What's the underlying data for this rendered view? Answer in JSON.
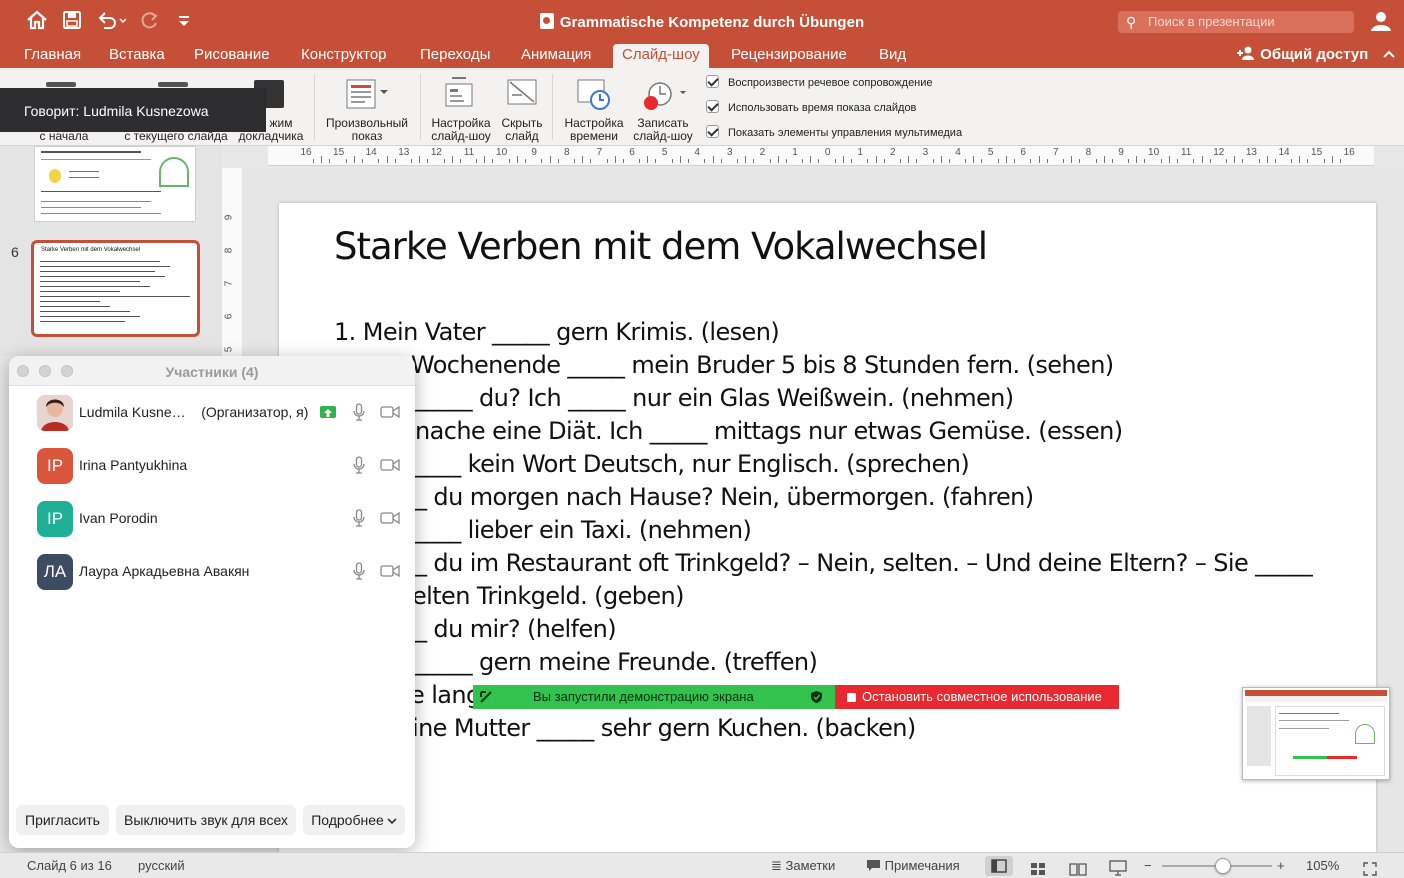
{
  "window": {
    "title": "Grammatische Kompetenz durch Übungen"
  },
  "search": {
    "placeholder": "Поиск в презентации"
  },
  "tabs": [
    {
      "label": "Главная"
    },
    {
      "label": "Вставка"
    },
    {
      "label": "Рисование"
    },
    {
      "label": "Конструктор"
    },
    {
      "label": "Переходы"
    },
    {
      "label": "Анимация"
    },
    {
      "label": "Слайд-шоу",
      "active": true
    },
    {
      "label": "Рецензирование"
    },
    {
      "label": "Вид"
    }
  ],
  "share": {
    "label": "Общий доступ"
  },
  "ribbon": {
    "from_start": "с начала",
    "from_current": "с текущего слайда",
    "presenter_partial": "жим",
    "presenter_mode": "докладчика",
    "custom_show": [
      "Произвольный",
      "показ"
    ],
    "setup_show": [
      "Настройка",
      "слайд-шоу"
    ],
    "hide_slide": [
      "Скрыть",
      "слайд"
    ],
    "rehearse": [
      "Настройка",
      "времени"
    ],
    "record": [
      "Записать",
      "слайд-шоу"
    ],
    "checkboxes": [
      {
        "label": "Воспроизвести речевое сопровождение",
        "checked": true
      },
      {
        "label": "Использовать время показа слайдов",
        "checked": true
      },
      {
        "label": "Показать элементы управления мультимедиа",
        "checked": true
      }
    ]
  },
  "speaker": {
    "text": "Говорит: Ludmila Kusnezowa"
  },
  "ruler": {
    "ticks": [
      "16",
      "15",
      "14",
      "13",
      "12",
      "11",
      "10",
      "9",
      "8",
      "7",
      "6",
      "5",
      "4",
      "3",
      "2",
      "1",
      "0",
      "1",
      "2",
      "3",
      "4",
      "5",
      "6",
      "7",
      "8",
      "9",
      "10",
      "11",
      "12",
      "13",
      "14",
      "15",
      "16"
    ],
    "vticks": [
      "9",
      "8",
      "7",
      "6",
      "5"
    ]
  },
  "thumbnails": {
    "current_number": "6",
    "current_title": "Starke Verben mit dem Vokalwechsel"
  },
  "slide": {
    "title": "Starke Verben mit dem Vokalwechsel",
    "lines": [
      "1. Mein Vater _____ gern Krimis. (lesen)",
      "Wochenende _____ mein Bruder 5 bis 8 Stunden fern. (sehen)",
      "_____ du? Ich _____ nur ein Glas Weißwein. (nehmen)",
      "nache eine Diät. Ich _____ mittags nur etwas Gemüse. (essen)",
      "____ kein Wort Deutsch, nur Englisch. (sprechen)",
      "_ du morgen nach Hause? Nein, übermorgen. (fahren)",
      "____ lieber ein Taxi. (nehmen)",
      "_ du im Restaurant oft Trinkgeld? – Nein, selten. – Und deine Eltern? – Sie _____",
      "elten Trinkgeld. (geben)",
      "_ du mir? (helfen)",
      "_____ gern meine Freunde. (treffen)",
      "e lang",
      "ine Mutter _____ sehr gern Kuchen. (backen)"
    ]
  },
  "participants": {
    "title": "Участники (4)",
    "list": [
      {
        "initials": "",
        "name": "Ludmila Kusne…",
        "role": "(Организатор, я)",
        "color": "#b83a2c"
      },
      {
        "initials": "IP",
        "name": "Irina Pantyukhina",
        "role": "",
        "color": "#d9563d"
      },
      {
        "initials": "IP",
        "name": "Ivan Porodin",
        "role": "",
        "color": "#1fae96"
      },
      {
        "initials": "ЛА",
        "name": "Лаура Аркадьевна Авакян",
        "role": "",
        "color": "#3d4b63"
      }
    ],
    "buttons": {
      "invite": "Пригласить",
      "mute_all": "Выключить звук для всех",
      "more": "Подробнее"
    }
  },
  "share_banner": {
    "status": "Вы запустили демонстрацию экрана",
    "stop": "Остановить совместное использование"
  },
  "status": {
    "slide": "Слайд 6 из 16",
    "language": "русский",
    "notes": "Заметки",
    "comments": "Примечания",
    "zoom": "105%",
    "zoom_fraction": 0.55
  },
  "colors": {
    "accent": "#c64f37",
    "share_green": "#32c24d",
    "stop_red": "#e8292f"
  }
}
